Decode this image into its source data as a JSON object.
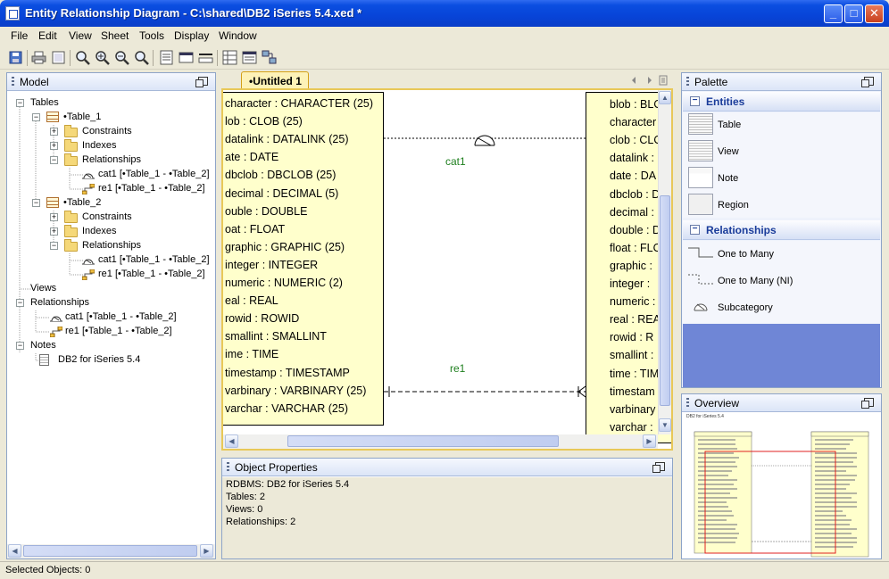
{
  "window": {
    "title": "Entity Relationship Diagram - C:\\shared\\DB2 iSeries 5.4.xed *"
  },
  "menu": [
    "File",
    "Edit",
    "View",
    "Sheet",
    "Tools",
    "Display",
    "Window"
  ],
  "model": {
    "title": "Model",
    "tree": {
      "tables": "Tables",
      "table1": "•Table_1",
      "table2": "•Table_2",
      "constraints": "Constraints",
      "indexes": "Indexes",
      "relationships": "Relationships",
      "cat1": "cat1 [•Table_1 - •Table_2]",
      "re1": "re1 [•Table_1 - •Table_2]",
      "views": "Views",
      "notes": "Notes",
      "note1": "DB2 for iSeries 5.4"
    }
  },
  "editor": {
    "tab": "•Untitled 1",
    "rel_cat1": "cat1",
    "rel_re1": "re1",
    "table1_columns": [
      "character : CHARACTER (25)",
      "lob : CLOB (25)",
      "datalink : DATALINK (25)",
      "ate : DATE",
      "dbclob : DBCLOB (25)",
      "decimal : DECIMAL (5)",
      "ouble : DOUBLE",
      "oat : FLOAT",
      "graphic : GRAPHIC (25)",
      "integer : INTEGER",
      "numeric : NUMERIC (2)",
      "eal : REAL",
      "rowid : ROWID",
      "smallint : SMALLINT",
      "ime : TIME",
      "timestamp : TIMESTAMP",
      "varbinary : VARBINARY (25)",
      "varchar : VARCHAR (25)"
    ],
    "table2_columns": [
      "blob : BLO",
      "character",
      "clob : CLO",
      "datalink :",
      "date : DA",
      "dbclob : D",
      "decimal :",
      "double : D",
      "float : FLO",
      "graphic :",
      "integer :",
      "numeric :",
      "real : REA",
      "rowid : R",
      "smallint :",
      "time : TIM",
      "timestam",
      "varbinary",
      "varchar :"
    ]
  },
  "properties": {
    "title": "Object Properties",
    "lines": [
      "RDBMS: DB2 for iSeries 5.4",
      "Tables: 2",
      "Views: 0",
      "Relationships: 2"
    ]
  },
  "palette": {
    "title": "Palette",
    "entities_section": "Entities",
    "entities": [
      "Table",
      "View",
      "Note",
      "Region"
    ],
    "relationships_section": "Relationships",
    "relationships": [
      "One to Many",
      "One to Many (NI)",
      "Subcategory"
    ]
  },
  "overview": {
    "title": "Overview",
    "note": "DB2 for iSeries 5.4"
  },
  "status": {
    "text": "Selected Objects: 0"
  },
  "colors": {
    "entity_fill": "#ffffcc",
    "tab_fill": "#fdf2b8",
    "label_green": "#208020",
    "overview_red": "#e02020"
  }
}
